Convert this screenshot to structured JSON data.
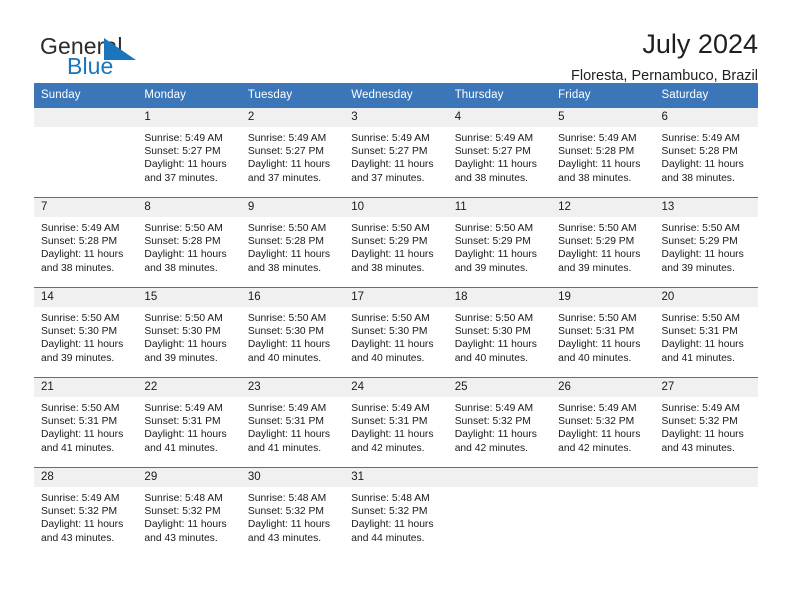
{
  "brand": {
    "name_part1": "General",
    "name_part2": "Blue",
    "logo_icon": "triangle-flag-icon",
    "accent_color": "#1b75bb"
  },
  "header": {
    "title": "July 2024",
    "subtitle": "Floresta, Pernambuco, Brazil"
  },
  "theme": {
    "header_bar_color": "#3b77b8",
    "daynum_bg_color": "#f0f0f0",
    "text_color": "#1a1a1a"
  },
  "calendar": {
    "weekday_headers": [
      "Sunday",
      "Monday",
      "Tuesday",
      "Wednesday",
      "Thursday",
      "Friday",
      "Saturday"
    ],
    "weeks": [
      [
        {
          "day": "",
          "sunrise": "",
          "sunset": "",
          "daylight_line1": "",
          "daylight_line2": ""
        },
        {
          "day": "1",
          "sunrise": "Sunrise: 5:49 AM",
          "sunset": "Sunset: 5:27 PM",
          "daylight_line1": "Daylight: 11 hours",
          "daylight_line2": "and 37 minutes."
        },
        {
          "day": "2",
          "sunrise": "Sunrise: 5:49 AM",
          "sunset": "Sunset: 5:27 PM",
          "daylight_line1": "Daylight: 11 hours",
          "daylight_line2": "and 37 minutes."
        },
        {
          "day": "3",
          "sunrise": "Sunrise: 5:49 AM",
          "sunset": "Sunset: 5:27 PM",
          "daylight_line1": "Daylight: 11 hours",
          "daylight_line2": "and 37 minutes."
        },
        {
          "day": "4",
          "sunrise": "Sunrise: 5:49 AM",
          "sunset": "Sunset: 5:27 PM",
          "daylight_line1": "Daylight: 11 hours",
          "daylight_line2": "and 38 minutes."
        },
        {
          "day": "5",
          "sunrise": "Sunrise: 5:49 AM",
          "sunset": "Sunset: 5:28 PM",
          "daylight_line1": "Daylight: 11 hours",
          "daylight_line2": "and 38 minutes."
        },
        {
          "day": "6",
          "sunrise": "Sunrise: 5:49 AM",
          "sunset": "Sunset: 5:28 PM",
          "daylight_line1": "Daylight: 11 hours",
          "daylight_line2": "and 38 minutes."
        }
      ],
      [
        {
          "day": "7",
          "sunrise": "Sunrise: 5:49 AM",
          "sunset": "Sunset: 5:28 PM",
          "daylight_line1": "Daylight: 11 hours",
          "daylight_line2": "and 38 minutes."
        },
        {
          "day": "8",
          "sunrise": "Sunrise: 5:50 AM",
          "sunset": "Sunset: 5:28 PM",
          "daylight_line1": "Daylight: 11 hours",
          "daylight_line2": "and 38 minutes."
        },
        {
          "day": "9",
          "sunrise": "Sunrise: 5:50 AM",
          "sunset": "Sunset: 5:28 PM",
          "daylight_line1": "Daylight: 11 hours",
          "daylight_line2": "and 38 minutes."
        },
        {
          "day": "10",
          "sunrise": "Sunrise: 5:50 AM",
          "sunset": "Sunset: 5:29 PM",
          "daylight_line1": "Daylight: 11 hours",
          "daylight_line2": "and 38 minutes."
        },
        {
          "day": "11",
          "sunrise": "Sunrise: 5:50 AM",
          "sunset": "Sunset: 5:29 PM",
          "daylight_line1": "Daylight: 11 hours",
          "daylight_line2": "and 39 minutes."
        },
        {
          "day": "12",
          "sunrise": "Sunrise: 5:50 AM",
          "sunset": "Sunset: 5:29 PM",
          "daylight_line1": "Daylight: 11 hours",
          "daylight_line2": "and 39 minutes."
        },
        {
          "day": "13",
          "sunrise": "Sunrise: 5:50 AM",
          "sunset": "Sunset: 5:29 PM",
          "daylight_line1": "Daylight: 11 hours",
          "daylight_line2": "and 39 minutes."
        }
      ],
      [
        {
          "day": "14",
          "sunrise": "Sunrise: 5:50 AM",
          "sunset": "Sunset: 5:30 PM",
          "daylight_line1": "Daylight: 11 hours",
          "daylight_line2": "and 39 minutes."
        },
        {
          "day": "15",
          "sunrise": "Sunrise: 5:50 AM",
          "sunset": "Sunset: 5:30 PM",
          "daylight_line1": "Daylight: 11 hours",
          "daylight_line2": "and 39 minutes."
        },
        {
          "day": "16",
          "sunrise": "Sunrise: 5:50 AM",
          "sunset": "Sunset: 5:30 PM",
          "daylight_line1": "Daylight: 11 hours",
          "daylight_line2": "and 40 minutes."
        },
        {
          "day": "17",
          "sunrise": "Sunrise: 5:50 AM",
          "sunset": "Sunset: 5:30 PM",
          "daylight_line1": "Daylight: 11 hours",
          "daylight_line2": "and 40 minutes."
        },
        {
          "day": "18",
          "sunrise": "Sunrise: 5:50 AM",
          "sunset": "Sunset: 5:30 PM",
          "daylight_line1": "Daylight: 11 hours",
          "daylight_line2": "and 40 minutes."
        },
        {
          "day": "19",
          "sunrise": "Sunrise: 5:50 AM",
          "sunset": "Sunset: 5:31 PM",
          "daylight_line1": "Daylight: 11 hours",
          "daylight_line2": "and 40 minutes."
        },
        {
          "day": "20",
          "sunrise": "Sunrise: 5:50 AM",
          "sunset": "Sunset: 5:31 PM",
          "daylight_line1": "Daylight: 11 hours",
          "daylight_line2": "and 41 minutes."
        }
      ],
      [
        {
          "day": "21",
          "sunrise": "Sunrise: 5:50 AM",
          "sunset": "Sunset: 5:31 PM",
          "daylight_line1": "Daylight: 11 hours",
          "daylight_line2": "and 41 minutes."
        },
        {
          "day": "22",
          "sunrise": "Sunrise: 5:49 AM",
          "sunset": "Sunset: 5:31 PM",
          "daylight_line1": "Daylight: 11 hours",
          "daylight_line2": "and 41 minutes."
        },
        {
          "day": "23",
          "sunrise": "Sunrise: 5:49 AM",
          "sunset": "Sunset: 5:31 PM",
          "daylight_line1": "Daylight: 11 hours",
          "daylight_line2": "and 41 minutes."
        },
        {
          "day": "24",
          "sunrise": "Sunrise: 5:49 AM",
          "sunset": "Sunset: 5:31 PM",
          "daylight_line1": "Daylight: 11 hours",
          "daylight_line2": "and 42 minutes."
        },
        {
          "day": "25",
          "sunrise": "Sunrise: 5:49 AM",
          "sunset": "Sunset: 5:32 PM",
          "daylight_line1": "Daylight: 11 hours",
          "daylight_line2": "and 42 minutes."
        },
        {
          "day": "26",
          "sunrise": "Sunrise: 5:49 AM",
          "sunset": "Sunset: 5:32 PM",
          "daylight_line1": "Daylight: 11 hours",
          "daylight_line2": "and 42 minutes."
        },
        {
          "day": "27",
          "sunrise": "Sunrise: 5:49 AM",
          "sunset": "Sunset: 5:32 PM",
          "daylight_line1": "Daylight: 11 hours",
          "daylight_line2": "and 43 minutes."
        }
      ],
      [
        {
          "day": "28",
          "sunrise": "Sunrise: 5:49 AM",
          "sunset": "Sunset: 5:32 PM",
          "daylight_line1": "Daylight: 11 hours",
          "daylight_line2": "and 43 minutes."
        },
        {
          "day": "29",
          "sunrise": "Sunrise: 5:48 AM",
          "sunset": "Sunset: 5:32 PM",
          "daylight_line1": "Daylight: 11 hours",
          "daylight_line2": "and 43 minutes."
        },
        {
          "day": "30",
          "sunrise": "Sunrise: 5:48 AM",
          "sunset": "Sunset: 5:32 PM",
          "daylight_line1": "Daylight: 11 hours",
          "daylight_line2": "and 43 minutes."
        },
        {
          "day": "31",
          "sunrise": "Sunrise: 5:48 AM",
          "sunset": "Sunset: 5:32 PM",
          "daylight_line1": "Daylight: 11 hours",
          "daylight_line2": "and 44 minutes."
        },
        {
          "day": "",
          "sunrise": "",
          "sunset": "",
          "daylight_line1": "",
          "daylight_line2": ""
        },
        {
          "day": "",
          "sunrise": "",
          "sunset": "",
          "daylight_line1": "",
          "daylight_line2": ""
        },
        {
          "day": "",
          "sunrise": "",
          "sunset": "",
          "daylight_line1": "",
          "daylight_line2": ""
        }
      ]
    ]
  }
}
